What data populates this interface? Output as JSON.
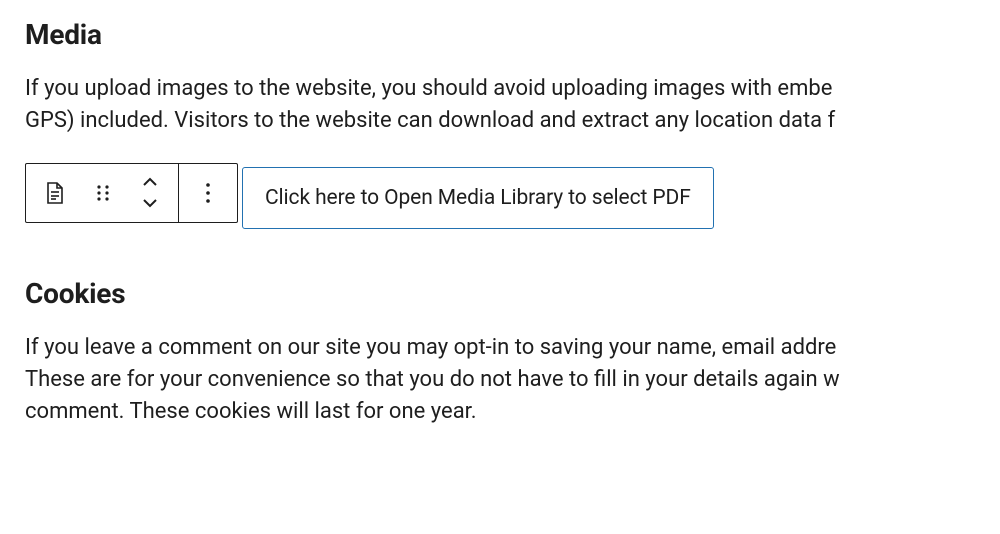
{
  "sections": {
    "media": {
      "heading": "Media",
      "paragraph_line1": "If you upload images to the website, you should avoid uploading images with embe",
      "paragraph_line2": "GPS) included. Visitors to the website can download and extract any location data f"
    },
    "cookies": {
      "heading": "Cookies",
      "paragraph_line1": "If you leave a comment on our site you may opt-in to saving your name, email addre",
      "paragraph_line2": "These are for your convenience so that you do not have to fill in your details again w",
      "paragraph_line3": "comment. These cookies will last for one year."
    }
  },
  "block": {
    "placeholder_label": "Click here to Open Media Library to select PDF"
  }
}
